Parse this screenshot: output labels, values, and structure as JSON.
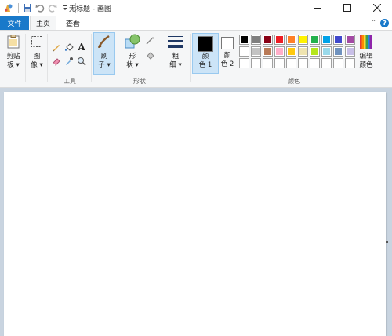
{
  "window": {
    "title": "无标题 - 画图",
    "controls": [
      "minimize-icon",
      "maximize-icon",
      "close-icon"
    ]
  },
  "tabs": {
    "file": "文件",
    "home": "主页",
    "view": "查看"
  },
  "ribbon": {
    "clipboard": {
      "label": "剪贴\n板 ▾",
      "l1": "剪贴",
      "l2": "板 ▾"
    },
    "image": {
      "l1": "图",
      "l2": "像 ▾"
    },
    "tools": {
      "group_label": "工具"
    },
    "brushes": {
      "l1": "刷",
      "l2": "子 ▾"
    },
    "shapes": {
      "l1": "形",
      "l2": "状 ▾",
      "group_label": "形状"
    },
    "size": {
      "l1": "粗",
      "l2": "细 ▾"
    },
    "color1": {
      "l1": "颜",
      "l2": "色 1"
    },
    "color2": {
      "l1": "颜",
      "l2": "色 2"
    },
    "edit_colors": {
      "l1": "编辑",
      "l2": "颜色"
    },
    "colors_group_label": "颜色",
    "palette": [
      [
        "#000000",
        "#7f7f7f",
        "#880015",
        "#ed1c24",
        "#ff7f27",
        "#fff200",
        "#22b14c",
        "#00a2e8",
        "#3f48cc",
        "#a349a4"
      ],
      [
        "#ffffff",
        "#c3c3c3",
        "#b97a57",
        "#ffaec9",
        "#ffc90e",
        "#efe4b0",
        "#b5e61d",
        "#99d9ea",
        "#7092be",
        "#c8bfe7"
      ],
      [
        "#ffffff",
        "#ffffff",
        "#ffffff",
        "#ffffff",
        "#ffffff",
        "#ffffff",
        "#ffffff",
        "#ffffff",
        "#ffffff",
        "#ffffff"
      ]
    ],
    "color1_value": "#000000",
    "color2_value": "#ffffff"
  },
  "accent": "#1979ca"
}
